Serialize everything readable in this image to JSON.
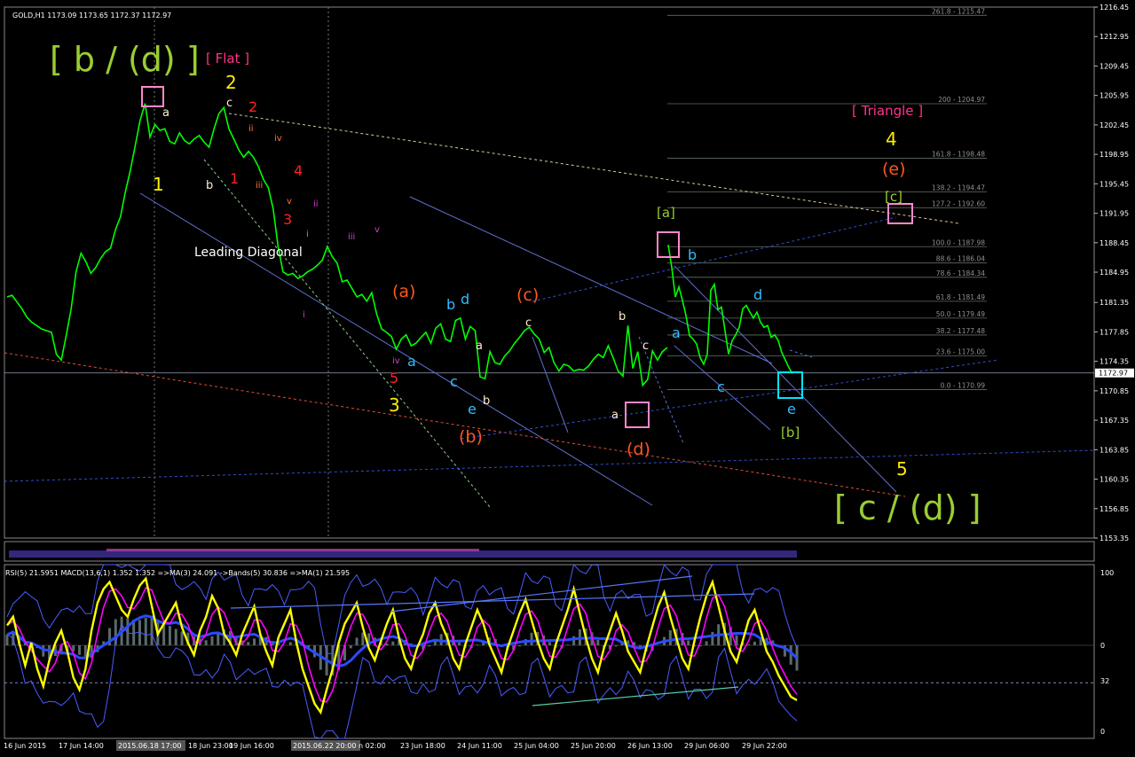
{
  "symbol_header": "GOLD,H1  1173.09 1173.65 1172.37 1172.97",
  "indicator_header": "RSI(5) 21.5951  MACD(13,6,1) 1.352 1.352  =>MA(3) 24.091  ->Bands(5) 30.836  =>MA(1) 21.595",
  "colors": {
    "background": "#000000",
    "candles": "#00ff00",
    "rsi": "#ffff00",
    "ma": "#ff00ff",
    "bands": "#4a5cff",
    "macd_line": "#2a4bff",
    "histogram": "#5a6a6a",
    "grid": "#808080",
    "channel": "#6070d0",
    "fib": "#708070"
  },
  "chart_data": {
    "type": "line",
    "title": "GOLD,H1",
    "ylim": [
      1153.35,
      1216.45
    ],
    "y_ticks": [
      "1216.45",
      "1212.95",
      "1209.45",
      "1205.95",
      "1202.45",
      "1198.95",
      "1195.45",
      "1191.95",
      "1188.45",
      "1184.95",
      "1181.35",
      "1177.85",
      "1174.35",
      "1170.85",
      "1167.35",
      "1163.85",
      "1160.35",
      "1156.85",
      "1153.35"
    ],
    "current_price": "1172.97",
    "x_ticks": [
      "16 Jun 2015",
      "17 Jun 14:00",
      "2015.06.18 17:00",
      "18 Jun 23:00",
      "19 Jun 16:00",
      "2015.06.22 20:00",
      "n 02:00",
      "23 Jun 18:00",
      "24 Jun 11:00",
      "25 Jun 04:00",
      "25 Jun 20:00",
      "26 Jun 13:00",
      "29 Jun 06:00",
      "29 Jun 22:00"
    ],
    "grid": false,
    "series": [
      {
        "type": "line",
        "values": [
          1182.0,
          1182.2,
          1181.4,
          1180.6,
          1179.6,
          1179.0,
          1178.6,
          1178.2,
          1178.0,
          1177.8,
          1175.2,
          1174.5,
          1177.4,
          1180.6,
          1185.0,
          1187.2,
          1186.2,
          1184.8,
          1185.5,
          1186.6,
          1187.4,
          1187.8,
          1190.0,
          1191.5,
          1194.5,
          1197.0,
          1200.0,
          1203.0,
          1205.0,
          1201.0,
          1202.5,
          1201.8,
          1202.0,
          1200.5,
          1200.2,
          1201.5,
          1200.6,
          1200.2,
          1200.8,
          1201.2,
          1200.4,
          1199.8,
          1202.0,
          1203.8,
          1204.5,
          1202.0,
          1200.8,
          1199.5,
          1198.6,
          1199.3,
          1198.6,
          1197.5,
          1196.0,
          1195.0,
          1192.5,
          1188.0,
          1185.0,
          1184.6,
          1184.8,
          1184.2,
          1184.5,
          1185.0,
          1185.3,
          1185.8,
          1186.4,
          1188.0,
          1186.8,
          1186.0,
          1183.8,
          1184.0,
          1183.0,
          1182.0,
          1182.3,
          1181.5,
          1182.5,
          1180.0,
          1178.2,
          1177.8,
          1177.3,
          1175.8,
          1177.0,
          1177.5,
          1176.2,
          1176.5,
          1177.2,
          1177.8,
          1176.5,
          1178.3,
          1178.8,
          1177.0,
          1176.7,
          1179.2,
          1179.5,
          1177.0,
          1178.5,
          1178.0,
          1172.5,
          1172.3,
          1175.5,
          1174.2,
          1174.0,
          1175.0,
          1175.6,
          1176.5,
          1177.2,
          1178.0,
          1178.4,
          1177.6,
          1177.0,
          1175.4,
          1176.0,
          1174.2,
          1173.2,
          1174.0,
          1173.8,
          1173.2,
          1173.4,
          1173.3,
          1173.8,
          1174.6,
          1175.2,
          1174.8,
          1176.2,
          1174.8,
          1173.2,
          1172.6,
          1178.6,
          1173.5,
          1175.5,
          1171.5,
          1172.2,
          1175.6,
          1174.5,
          1175.5,
          1176.0
        ],
        "name": ""
      },
      {
        "type": "line",
        "values": [
          1188.2,
          1185.5,
          1182.0,
          1183.2,
          1181.6,
          1179.8,
          1177.4,
          1177.0,
          1176.4,
          1174.8,
          1174.0,
          1175.2,
          1182.8,
          1183.5,
          1180.5,
          1180.8,
          1178.0,
          1175.2,
          1176.8,
          1177.5,
          1178.4,
          1180.6,
          1181.0,
          1180.2,
          1179.5,
          1180.2,
          1179.0,
          1178.4,
          1178.6,
          1177.2,
          1177.5,
          1176.8,
          1175.4,
          1174.5,
          1173.6,
          1172.9
        ],
        "name": ""
      }
    ],
    "annotations": {
      "waves_main": [
        "[ b / (d) ]",
        "[ Flat ]",
        "[ Triangle ]",
        "[ c / (d) ]",
        "Leading Diagonal"
      ],
      "yellow": [
        "1",
        "2",
        "3",
        "4",
        "5"
      ],
      "red_digits": [
        "1",
        "2",
        "3",
        "4",
        "5"
      ],
      "orange_letters": [
        "(a)",
        "(b)",
        "(c)",
        "(d)",
        "(e)"
      ],
      "cyan_letters": [
        "a",
        "b",
        "c",
        "d",
        "e",
        "a",
        "b",
        "c",
        "d",
        "e"
      ],
      "white_letters": [
        "a",
        "b",
        "c",
        "a",
        "b",
        "c",
        "a",
        "b",
        "c"
      ],
      "roman": [
        "i",
        "ii",
        "iii",
        "iv",
        "v",
        "i",
        "ii",
        "iii",
        "iv",
        "v"
      ],
      "green_brackets": [
        "[a]",
        "[b]",
        "[c]"
      ]
    },
    "fib_levels": [
      {
        "label": "261.8 - 1215.47",
        "value": 1215.47
      },
      {
        "label": "200 - 1204.97",
        "value": 1204.97
      },
      {
        "label": "161.8 - 1198.48",
        "value": 1198.48
      },
      {
        "label": "138.2 - 1194.47",
        "value": 1194.47
      },
      {
        "label": "127.2 - 1192.60",
        "value": 1192.6
      },
      {
        "label": "100.0 - 1187.98",
        "value": 1187.98
      },
      {
        "label": "88.6 - 1186.04",
        "value": 1186.04
      },
      {
        "label": "78.6 - 1184.34",
        "value": 1184.34
      },
      {
        "label": "61.8 - 1181.49",
        "value": 1181.49
      },
      {
        "label": "50.0 - 1179.49",
        "value": 1179.49
      },
      {
        "label": "38.2 - 1177.48",
        "value": 1177.48
      },
      {
        "label": "23.6 - 1175.00",
        "value": 1175.0
      },
      {
        "label": "0.0 - 1170.99",
        "value": 1170.99
      }
    ],
    "indicator": {
      "ylim": [
        0,
        100
      ],
      "y_ticks": [
        "100",
        "0",
        "32",
        "0"
      ],
      "rsi_values": [
        65,
        70,
        55,
        42,
        55,
        40,
        30,
        45,
        55,
        62,
        50,
        35,
        28,
        40,
        62,
        78,
        86,
        90,
        82,
        74,
        70,
        80,
        88,
        92,
        76,
        60,
        66,
        72,
        78,
        64,
        55,
        48,
        62,
        70,
        82,
        75,
        60,
        55,
        48,
        60,
        68,
        76,
        60,
        50,
        42,
        58,
        66,
        74,
        55,
        40,
        30,
        20,
        15,
        28,
        40,
        55,
        66,
        72,
        78,
        64,
        52,
        45,
        56,
        66,
        74,
        58,
        46,
        40,
        52,
        60,
        72,
        78,
        66,
        58,
        46,
        40,
        54,
        64,
        74,
        66,
        54,
        46,
        38,
        52,
        62,
        72,
        80,
        68,
        56,
        46,
        40,
        54,
        64,
        74,
        86,
        72,
        58,
        46,
        38,
        52,
        62,
        72,
        62,
        50,
        44,
        38,
        52,
        64,
        76,
        84,
        70,
        58,
        46,
        40,
        56,
        70,
        82,
        90,
        76,
        62,
        50,
        44,
        56,
        68,
        74,
        62,
        50,
        44,
        36,
        30,
        24,
        22
      ]
    }
  }
}
